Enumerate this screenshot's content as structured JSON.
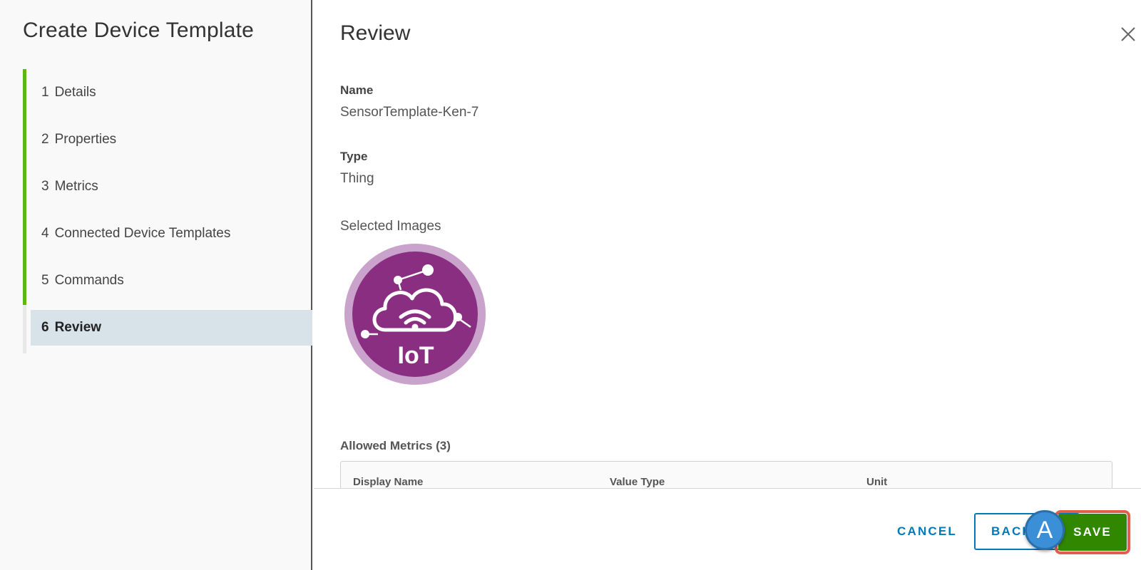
{
  "wizard": {
    "title": "Create Device Template",
    "steps": [
      {
        "num": "1",
        "label": "Details"
      },
      {
        "num": "2",
        "label": "Properties"
      },
      {
        "num": "3",
        "label": "Metrics"
      },
      {
        "num": "4",
        "label": "Connected Device Templates"
      },
      {
        "num": "5",
        "label": "Commands"
      },
      {
        "num": "6",
        "label": "Review"
      }
    ],
    "active_step": "6"
  },
  "review": {
    "title": "Review",
    "name_label": "Name",
    "name_value": "SensorTemplate-Ken-7",
    "type_label": "Type",
    "type_value": "Thing",
    "images_label": "Selected Images",
    "image_text": "IoT",
    "metrics_label": "Allowed Metrics (3)",
    "metrics_columns": [
      "Display Name",
      "Value Type",
      "Unit"
    ]
  },
  "footer": {
    "cancel_label": "CANCEL",
    "back_label": "BACK",
    "save_label": "SAVE",
    "marker_label": "A"
  },
  "colors": {
    "accent_green": "#60b515",
    "save_green": "#318700",
    "link_blue": "#0079b8",
    "iot_purple": "#8a2e82",
    "highlight_red": "#e35d4f"
  }
}
